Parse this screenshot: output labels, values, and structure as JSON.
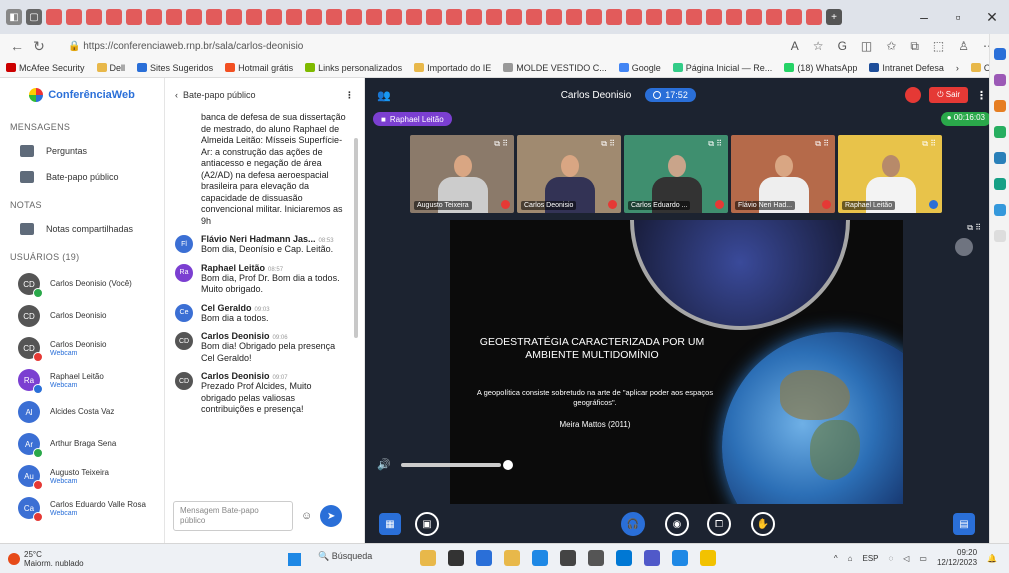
{
  "browser": {
    "url": "https://conferenciaweb.rnp.br/sala/carlos-deonisio",
    "favorites": [
      "McAfee Security",
      "Dell",
      "Sites Sugeridos",
      "Hotmail grátis",
      "Links personalizados",
      "Importado do IE",
      "MOLDE VESTIDO C...",
      "Google",
      "Página Inicial — Re...",
      "(18) WhatsApp",
      "Intranet Defesa",
      "Outros favoritos"
    ]
  },
  "sidebar": {
    "logo": "ConferênciaWeb",
    "sec_messages": "MENSAGENS",
    "item_questions": "Perguntas",
    "item_public_chat": "Bate-papo público",
    "sec_notes": "NOTAS",
    "item_shared_notes": "Notas compartilhadas",
    "sec_users": "USUÁRIOS (19)",
    "users": [
      {
        "name": "Carlos Deonisio (Você)",
        "initials": "CD",
        "sub": ""
      },
      {
        "name": "Carlos Deonisio",
        "initials": "CD",
        "sub": ""
      },
      {
        "name": "Carlos Deonisio",
        "initials": "CD",
        "sub": "Webcam"
      },
      {
        "name": "Raphael Leitão",
        "initials": "Ra",
        "sub": "Webcam"
      },
      {
        "name": "Alcides Costa Vaz",
        "initials": "Al",
        "sub": ""
      },
      {
        "name": "Arthur Braga Sena",
        "initials": "Ar",
        "sub": ""
      },
      {
        "name": "Augusto Teixeira",
        "initials": "Au",
        "sub": "Webcam"
      },
      {
        "name": "Carlos Eduardo Valle Rosa",
        "initials": "Ca",
        "sub": "Webcam"
      }
    ]
  },
  "chat": {
    "header": "Bate-papo público",
    "intro_text": "banca de defesa de sua dissertação de mestrado, do aluno Raphael de Almeida Leitão: Mísseis Superfície-Ar: a construção das ações de antiacesso e negação de área (A2/AD) na defesa aeroespacial brasileira para elevação da capacidade de dissuasão convencional militar. Iniciaremos as 9h",
    "messages": [
      {
        "initials": "Fl",
        "who": "Flávio Neri Hadmann Jas...",
        "time": "08:53",
        "text": "Bom dia, Deonísio e Cap. Leitão."
      },
      {
        "initials": "Ra",
        "who": "Raphael Leitão",
        "time": "08:57",
        "text": "Bom dia, Prof Dr. Bom dia a todos. Muito obrigado."
      },
      {
        "initials": "Ce",
        "who": "Cel Geraldo",
        "time": "09:03",
        "text": "Bom dia a todos."
      },
      {
        "initials": "CD",
        "who": "Carlos Deonisio",
        "time": "09:06",
        "text": "Bom dia! Obrigado pela presença Cel Geraldo!"
      },
      {
        "initials": "CD",
        "who": "Carlos Deonisio",
        "time": "09:07",
        "text": "Prezado Prof Alcides, Muito obrigado pelas valiosas contribuições e presença!"
      }
    ],
    "placeholder": "Mensagem Bate-papo público"
  },
  "meeting": {
    "title": "Carlos Deonisio",
    "clock": "17:52",
    "leave": "Sair",
    "presenter": "Raphael Leitão",
    "elapsed": "00:16:03",
    "participants": [
      "Augusto Teixeira",
      "Carlos Deonisio",
      "Carlos Eduardo ...",
      "Flávio Neri Had...",
      "Raphael Leitão"
    ]
  },
  "slide": {
    "title": "GEOESTRATÉGIA CARACTERIZADA POR UM AMBIENTE MULTIDOMÍNIO",
    "quote": "A geopolítica consiste sobretudo na arte de \"aplicar poder aos espaços geográficos\".",
    "author": "Meira Mattos (2011)"
  },
  "taskbar": {
    "temp": "25°C",
    "weather": "Maiorm. nublado",
    "search": "Búsqueda",
    "lang": "ESP",
    "time": "09:20",
    "date": "12/12/2023"
  }
}
